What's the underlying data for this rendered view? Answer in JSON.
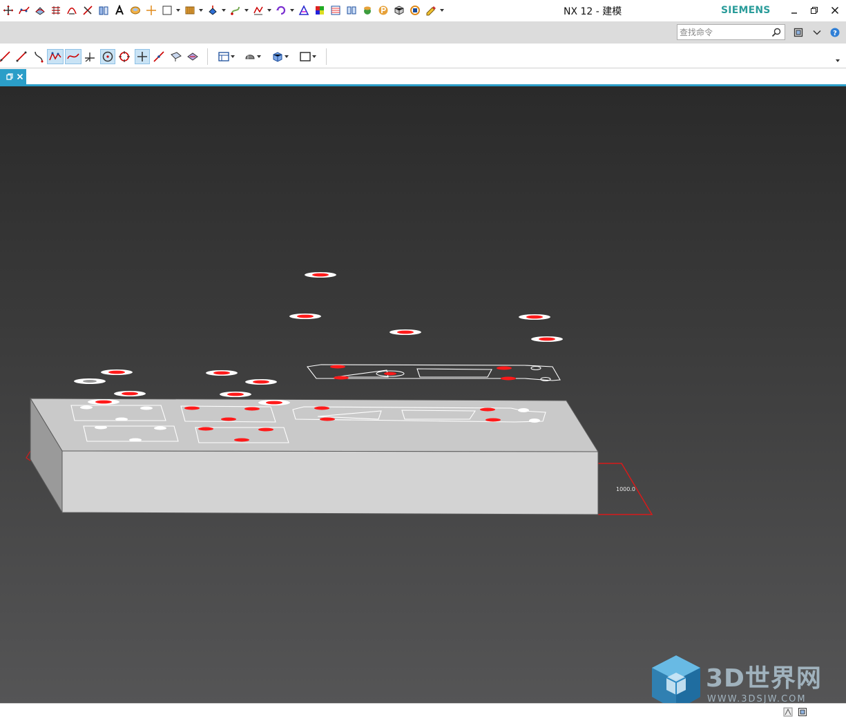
{
  "window": {
    "title": "NX 12 - 建模",
    "brand": "SIEMENS"
  },
  "quick_access": {
    "icons": [
      "move-handle-icon",
      "spline-icon",
      "studio-surface-icon",
      "curve-network-icon",
      "through-curves-icon",
      "extrude-icon",
      "cylinder-icon",
      "text-icon",
      "shading-icon",
      "point-icon",
      "sketch-icon",
      "feature-group-icon",
      "paint-icon",
      "snap-icon",
      "analysis-icon",
      "rotate-icon",
      "nurbs-icon",
      "color-palette-icon",
      "reuse-library-icon",
      "layer-icon",
      "render-icon",
      "part-navigator-icon",
      "assembly-icon",
      "teamcenter-icon",
      "edit-icon"
    ]
  },
  "search": {
    "placeholder": "查找命令"
  },
  "toolbar": {
    "icons": [
      "line-icon",
      "straight-line-icon",
      "bridge-curve-icon",
      "studio-spline-icon",
      "fit-curve-icon",
      "plane-normal-icon",
      "circle-center-icon",
      "circle-icon",
      "point-icon",
      "line-tangent-icon",
      "surface-icon",
      "face-icon",
      "view-layout-icon",
      "render-style-icon",
      "cube-icon",
      "rectangle-icon"
    ]
  },
  "tab": {
    "icons": [
      "restore-tab-icon",
      "close-tab-icon"
    ]
  },
  "viewport": {
    "dimension_label": "1000.0"
  },
  "watermark": {
    "brand": "3D世界网",
    "url": "WWW.3DSJW.COM"
  },
  "colors": {
    "accent": "#2b9ec8",
    "brand": "#2a9c9a",
    "highlight_red": "#ff1a1a",
    "block_top": "#c8c8c8",
    "block_front": "#d2d2d2"
  }
}
